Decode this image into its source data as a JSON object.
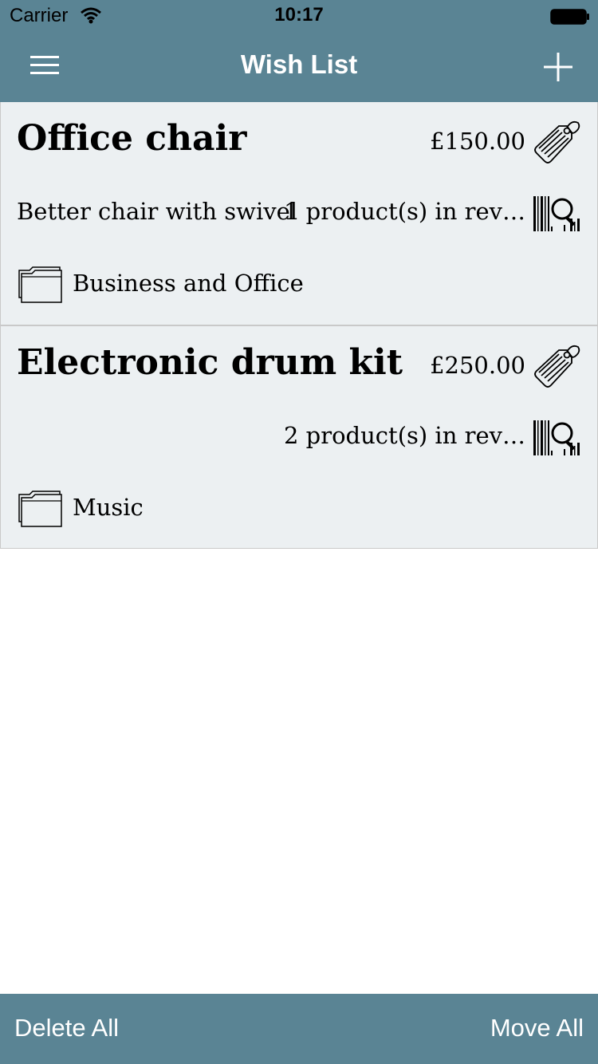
{
  "status_bar": {
    "carrier": "Carrier",
    "time": "10:17"
  },
  "nav": {
    "title": "Wish List",
    "menu_icon": "hamburger-menu-icon",
    "add_icon": "plus-icon"
  },
  "items": [
    {
      "title": "Office chair",
      "price": "£150.00",
      "note": "Better chair with swivel",
      "review": "1 product(s) in rev…",
      "category": "Business and Office"
    },
    {
      "title": "Electronic drum kit",
      "price": "£250.00",
      "note": "",
      "review": "2 product(s) in rev…",
      "category": "Music"
    }
  ],
  "toolbar": {
    "delete_all": "Delete All",
    "move_all": "Move All"
  },
  "colors": {
    "bar": "#5a8494",
    "card": "#ecf0f2",
    "white": "#ffffff"
  }
}
